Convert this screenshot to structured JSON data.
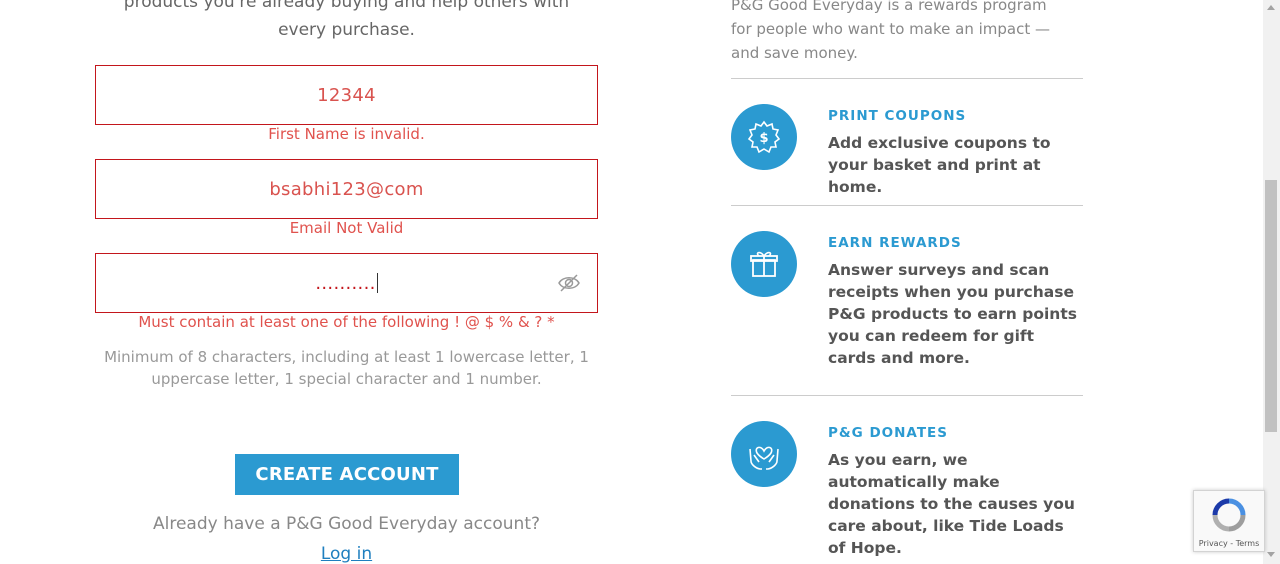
{
  "signup": {
    "intro_line1": "products you're already buying and help others with",
    "intro_line2": "every purchase.",
    "first_name": {
      "value": "12344",
      "error": "First Name is invalid."
    },
    "email": {
      "value": "bsabhi123@com",
      "error": "Email Not Valid"
    },
    "password": {
      "value": "..........",
      "error": "Must contain at least one of the following  ! @ $ % & ? *"
    },
    "password_hint_line1": "Minimum of 8 characters, including at least 1 lowercase letter, 1",
    "password_hint_line2": "uppercase letter, 1 special character and 1 number.",
    "create_button": "CREATE ACCOUNT",
    "already_text": "Already have a P&G Good Everyday account?",
    "login_link": "Log in"
  },
  "benefits": {
    "intro_line1": "P&G Good Everyday is a rewards program",
    "intro_line2": "for people who want to make an impact —",
    "intro_line3": "and save money.",
    "items": [
      {
        "title": "PRINT COUPONS",
        "desc": "Add exclusive coupons to your basket and print at home.",
        "icon": "coupon-icon"
      },
      {
        "title": "EARN REWARDS",
        "desc": "Answer surveys and scan receipts when you purchase P&G products to earn points you can redeem for gift cards and more.",
        "icon": "gift-icon"
      },
      {
        "title": "P&G DONATES",
        "desc": "As you earn, we automatically make donations to the causes you care about, like Tide Loads of Hope.",
        "icon": "heart-hands-icon"
      }
    ]
  },
  "recaptcha": {
    "label": "Privacy - Terms"
  },
  "colors": {
    "accent": "#2b9ad1",
    "error": "#c3161c"
  }
}
